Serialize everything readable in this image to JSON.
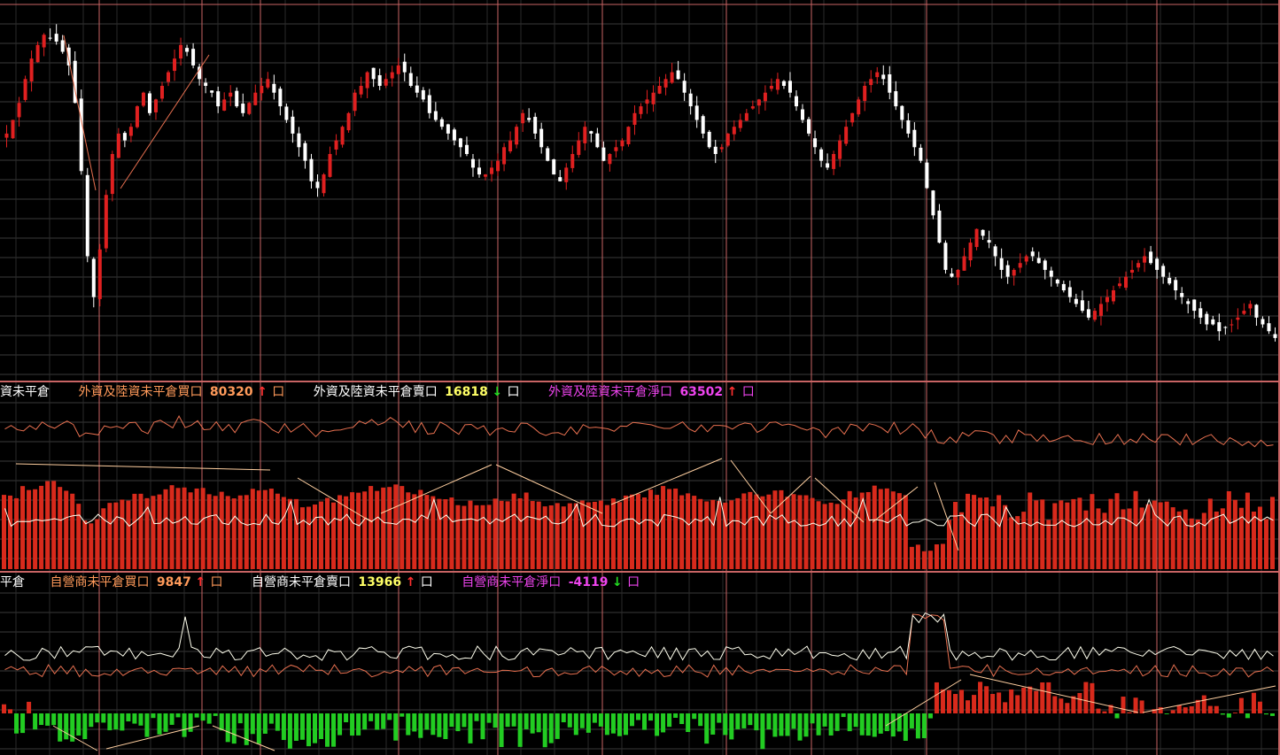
{
  "colors": {
    "background": "#000000",
    "grid_vertical": "#c86464",
    "grid_horizontal": "#3a3a3a",
    "up": "#e02020",
    "down": "#ffffff",
    "buy_line": "#e87050",
    "sell_line": "#ffffee",
    "net_positive": "#d82a1c",
    "net_negative": "#22cc22",
    "text_orange": "#ff9a5a",
    "text_white": "#ffffff",
    "text_magenta": "#ee44ee",
    "value_yellow": "#ffff66",
    "arrow_up": "#ff3030",
    "arrow_down": "#22dd22"
  },
  "icons": {
    "up": "arrow-up-icon",
    "down": "arrow-down-icon",
    "box": "square-box-icon"
  },
  "legend_foreign": {
    "title": "資未平倉",
    "buy_label": "外資及陸資未平倉買口",
    "buy_value": "80320",
    "buy_arrow": "↑",
    "sell_label": "外資及陸資未平倉賣口",
    "sell_value": "16818",
    "sell_arrow": "↓",
    "net_label": "外資及陸資未平倉淨口",
    "net_value": "63502",
    "net_arrow": "↑",
    "box": "口"
  },
  "legend_dealer": {
    "title": "平倉",
    "buy_label": "自營商未平倉買口",
    "buy_value": "9847",
    "buy_arrow": "↑",
    "sell_label": "自營商未平倉賣口",
    "sell_value": "13966",
    "sell_arrow": "↑",
    "net_label": "自營商未平倉淨口",
    "net_value": "-4119",
    "net_arrow": "↓",
    "box": "口"
  },
  "chart_data": [
    {
      "type": "candlestick",
      "description_note": "",
      "points": 205,
      "close": [
        66,
        70,
        75,
        82,
        88,
        92,
        95,
        94,
        93,
        90,
        86,
        75,
        55,
        30,
        18,
        32,
        48,
        60,
        66,
        64,
        68,
        74,
        78,
        72,
        76,
        80,
        84,
        88,
        92,
        90,
        86,
        82,
        80,
        78,
        74,
        76,
        78,
        74,
        72,
        75,
        78,
        80,
        82,
        78,
        74,
        70,
        66,
        62,
        58,
        52,
        50,
        54,
        60,
        64,
        68,
        72,
        78,
        80,
        84,
        82,
        80,
        82,
        84,
        86,
        84,
        80,
        78,
        76,
        72,
        70,
        68,
        66,
        64,
        62,
        60,
        56,
        54,
        54,
        56,
        58,
        62,
        64,
        68,
        72,
        70,
        66,
        62,
        58,
        54,
        52,
        56,
        60,
        64,
        68,
        66,
        62,
        58,
        60,
        62,
        64,
        68,
        72,
        74,
        76,
        78,
        80,
        82,
        84,
        82,
        78,
        74,
        70,
        66,
        62,
        60,
        62,
        66,
        68,
        70,
        72,
        74,
        76,
        78,
        80,
        82,
        80,
        78,
        74,
        70,
        66,
        62,
        58,
        56,
        60,
        64,
        68,
        72,
        76,
        80,
        82,
        84,
        82,
        78,
        74,
        70,
        66,
        62,
        58,
        50,
        42,
        34,
        26,
        24,
        26,
        30,
        34,
        38,
        36,
        34,
        30,
        26,
        24,
        26,
        28,
        30,
        30,
        28,
        26,
        24,
        22,
        20,
        18,
        16,
        14,
        12,
        14,
        16,
        18,
        20,
        22,
        24,
        26,
        28,
        30,
        28,
        26,
        24,
        22,
        20,
        18,
        16,
        14,
        12,
        10,
        10,
        8,
        9,
        10,
        12,
        14,
        16,
        12,
        10,
        8,
        6
      ],
      "note": ""
    },
    {
      "type": "bar+line",
      "series": [
        {
          "name": "外資及陸資未平倉買口",
          "values_last": 80320
        },
        {
          "name": "外資及陸資未平倉賣口",
          "values_last": 16818
        },
        {
          "name": "外資及陸資未平倉淨口",
          "values_last": 63502
        }
      ]
    },
    {
      "type": "bar+line",
      "series": [
        {
          "name": "自營商未平倉買口",
          "values_last": 9847
        },
        {
          "name": "自營商未平倉賣口",
          "values_last": 13966
        },
        {
          "name": "自營商未平倉淨口",
          "values_last": -4119
        }
      ]
    }
  ]
}
